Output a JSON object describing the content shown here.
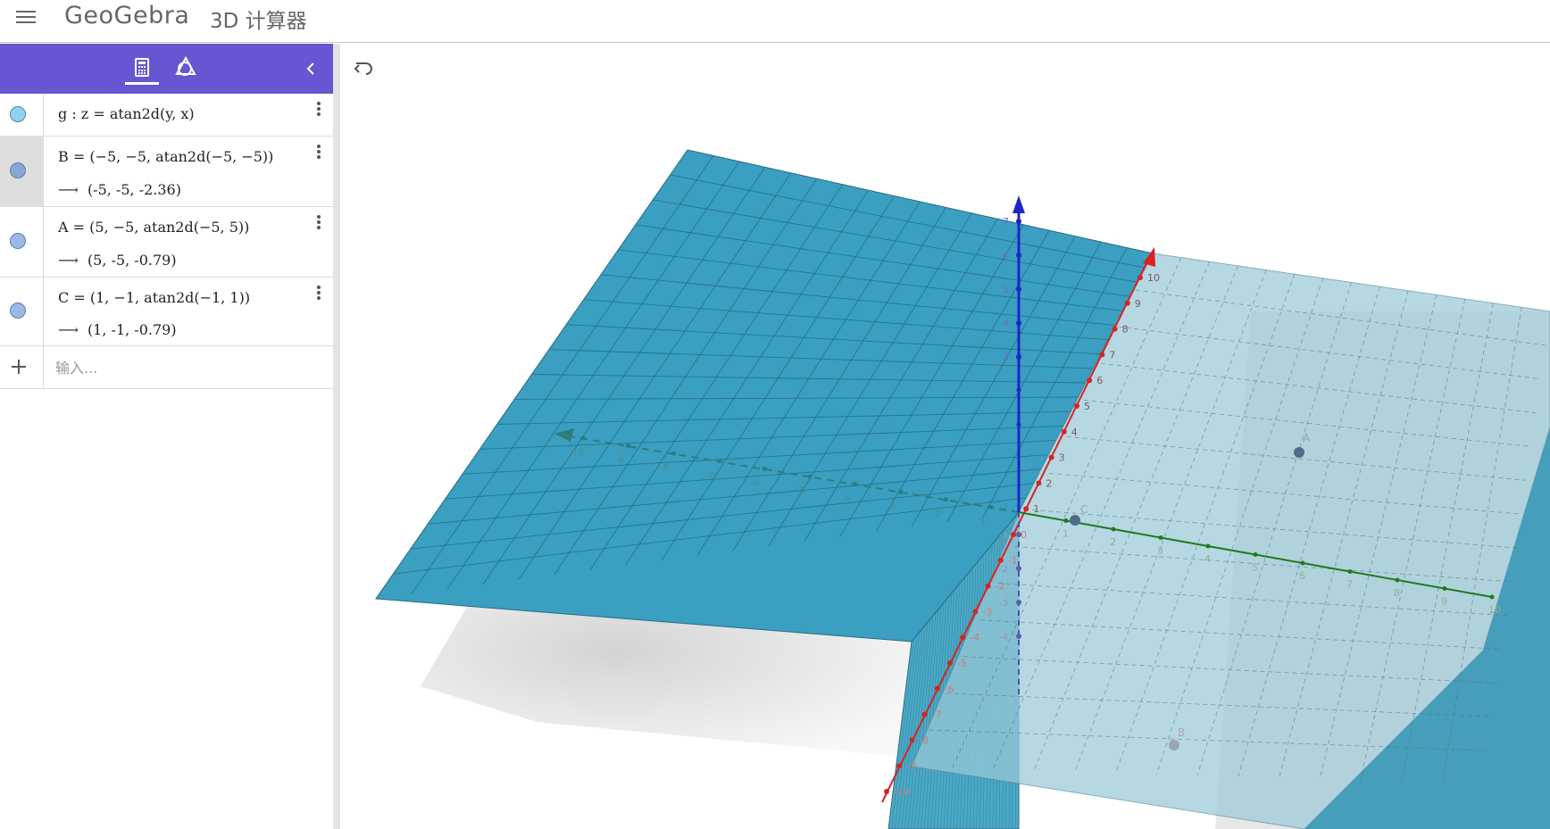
{
  "header": {
    "brand": "GeoGebra",
    "app_name": "3D 计算器"
  },
  "colors": {
    "panel_header": "#6557d2",
    "surface": "#3fa3c2",
    "x_axis": "#d42424",
    "y_axis": "#1f7a1f",
    "z_axis": "#1f24c8"
  },
  "icons": {
    "menu": "menu-icon",
    "algebra_tab": "calculator-icon",
    "tools_tab": "tools-icon",
    "collapse": "chevron-left-icon",
    "undo": "undo-icon",
    "more": "more-vertical-icon",
    "add": "plus-icon"
  },
  "algebra": {
    "items": [
      {
        "definition": "g : z = atan2d(y, x)",
        "output": "",
        "color": "#8ed3ee"
      },
      {
        "definition": "B = (−5, −5, atan2d(−5, −5))",
        "output": "(-5, -5, -2.36)",
        "color": "#8aa6d4"
      },
      {
        "definition": "A = (5, −5, atan2d(−5, 5))",
        "output": "(5, -5, -0.79)",
        "color": "#9ab9e3"
      },
      {
        "definition": "C = (1, −1, atan2d(−1, 1))",
        "output": "(1, -1, -0.79)",
        "color": "#9ab9e3"
      }
    ],
    "output_arrow": "⟶",
    "input_placeholder": "输入..."
  },
  "scene": {
    "x_ticks": [
      "10",
      "9",
      "8",
      "7",
      "6",
      "5",
      "4",
      "3",
      "2",
      "1",
      "0",
      "-1",
      "-2",
      "-3",
      "-4",
      "-5",
      "-6",
      "-7",
      "-8",
      "-9",
      "-10"
    ],
    "y_ticks": [
      "1",
      "2",
      "3",
      "4",
      "5",
      "6",
      "7",
      "8",
      "9",
      "10"
    ],
    "neg_y_ticks": [
      "10",
      "9",
      "8",
      "7",
      "6",
      "5",
      "4",
      "3",
      "2",
      "1"
    ],
    "z_ticks": [
      "7",
      "6",
      "5",
      "4",
      "3"
    ],
    "neg_z_ticks": [
      "-1",
      "-2",
      "-3",
      "-4"
    ],
    "point_labels": {
      "A": "A",
      "B": "B",
      "C": "C"
    }
  }
}
